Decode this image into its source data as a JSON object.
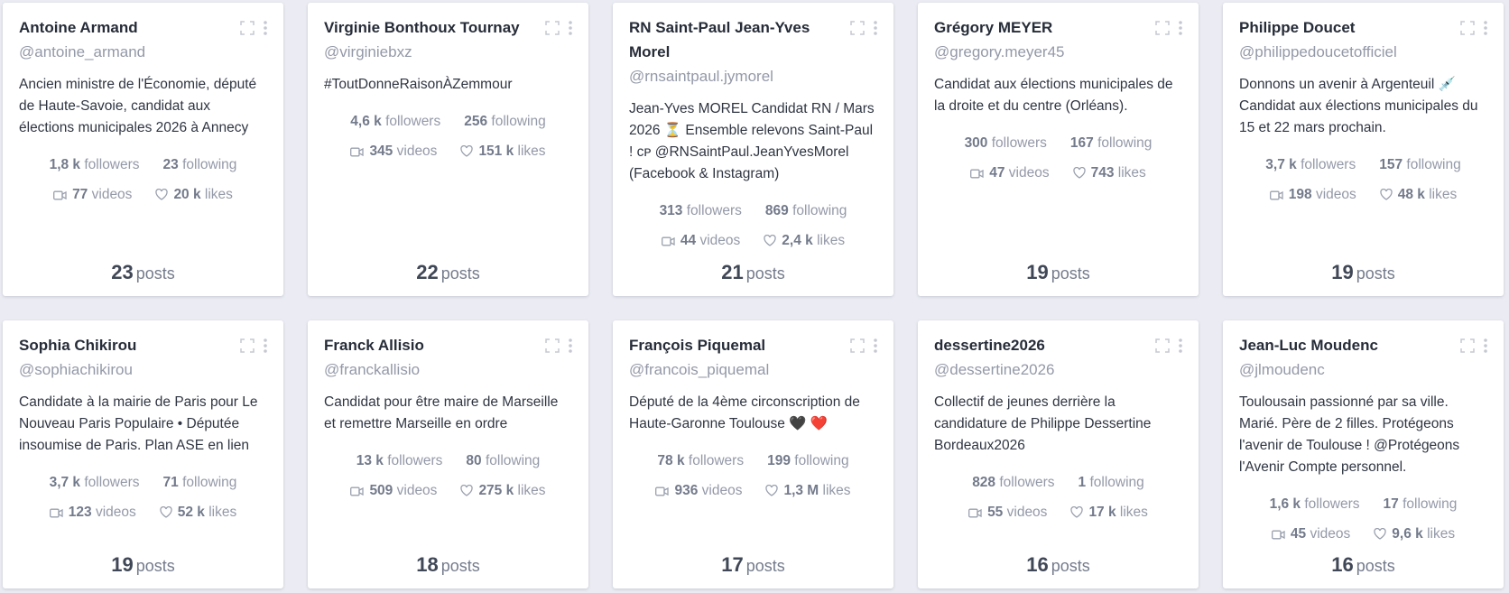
{
  "labels": {
    "followers": "followers",
    "following": "following",
    "videos": "videos",
    "likes": "likes",
    "posts": "posts"
  },
  "cards": [
    {
      "name": "Antoine Armand",
      "handle": "@antoine_armand",
      "bio": "Ancien ministre de l'Économie, député de Haute-Savoie, candidat aux élections municipales 2026 à Annecy",
      "followers": "1,8 k",
      "following": "23",
      "videos": "77",
      "likes": "20 k",
      "posts": "23"
    },
    {
      "name": "Virginie Bonthoux Tournay",
      "handle": "@virginiebxz",
      "bio": "#ToutDonneRaisonÀZemmour",
      "followers": "4,6 k",
      "following": "256",
      "videos": "345",
      "likes": "151 k",
      "posts": "22"
    },
    {
      "name": "RN Saint-Paul Jean-Yves Morel",
      "handle": "@rnsaintpaul.jymorel",
      "bio": "Jean-Yves MOREL Candidat RN / Mars 2026 ⏳ Ensemble relevons Saint-Paul ! ᴄᴘ @RNSaintPaul.JeanYvesMorel (Facebook & Instagram)",
      "followers": "313",
      "following": "869",
      "videos": "44",
      "likes": "2,4 k",
      "posts": "21"
    },
    {
      "name": "Grégory MEYER",
      "handle": "@gregory.meyer45",
      "bio": "Candidat aux élections municipales de la droite et du centre (Orléans).",
      "followers": "300",
      "following": "167",
      "videos": "47",
      "likes": "743",
      "posts": "19"
    },
    {
      "name": "Philippe Doucet",
      "handle": "@philippedoucetofficiel",
      "bio": "Donnons un avenir à Argenteuil 💉 Candidat aux élections municipales du 15 et 22 mars prochain.",
      "followers": "3,7 k",
      "following": "157",
      "videos": "198",
      "likes": "48 k",
      "posts": "19"
    },
    {
      "name": "Sophia Chikirou",
      "handle": "@sophiachikirou",
      "bio": "Candidate à la mairie de Paris pour Le Nouveau Paris Populaire • Députée insoumise de Paris. Plan ASE en lien",
      "followers": "3,7 k",
      "following": "71",
      "videos": "123",
      "likes": "52 k",
      "posts": "19"
    },
    {
      "name": "Franck Allisio",
      "handle": "@franckallisio",
      "bio": "Candidat pour être maire de Marseille et remettre Marseille en ordre",
      "followers": "13 k",
      "following": "80",
      "videos": "509",
      "likes": "275 k",
      "posts": "18"
    },
    {
      "name": "François Piquemal",
      "handle": "@francois_piquemal",
      "bio": "Député de la 4ème circonscription de Haute-Garonne Toulouse 🖤 ❤️",
      "followers": "78 k",
      "following": "199",
      "videos": "936",
      "likes": "1,3 M",
      "posts": "17"
    },
    {
      "name": "dessertine2026",
      "handle": "@dessertine2026",
      "bio": "Collectif de jeunes derrière la candidature de Philippe Dessertine Bordeaux2026",
      "followers": "828",
      "following": "1",
      "videos": "55",
      "likes": "17 k",
      "posts": "16"
    },
    {
      "name": "Jean-Luc Moudenc",
      "handle": "@jlmoudenc",
      "bio": "Toulousain passionné par sa ville. Marié. Père de 2 filles. Protégeons l'avenir de Toulouse ! @Protégeons l'Avenir Compte personnel.",
      "followers": "1,6 k",
      "following": "17",
      "videos": "45",
      "likes": "9,6 k",
      "posts": "16"
    }
  ]
}
